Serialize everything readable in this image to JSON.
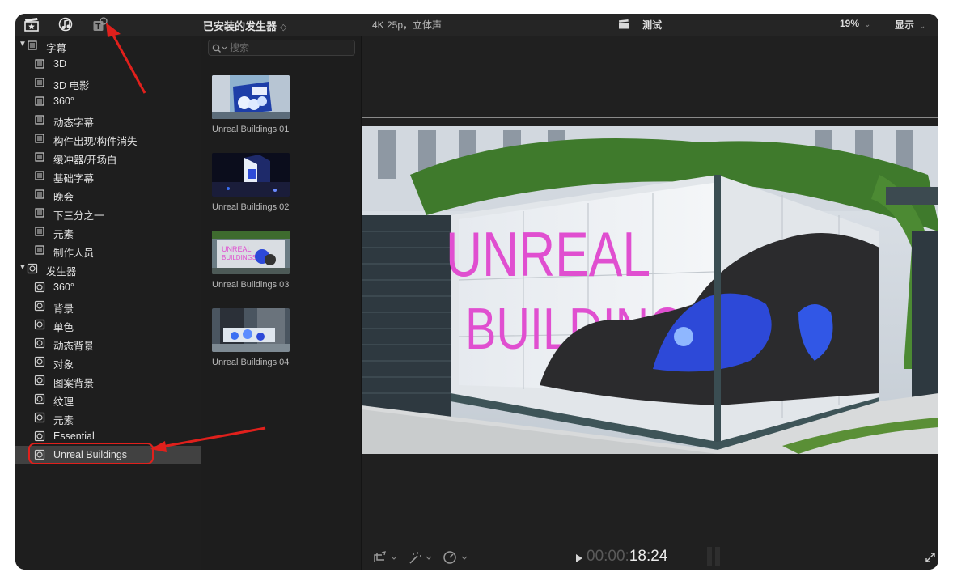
{
  "toolbar": {
    "icons": [
      "clapper-star-icon",
      "music-note-icon",
      "title-t-icon"
    ],
    "browser_title": "已安装的发生器",
    "browser_title_chevron": "◇",
    "format_label": "4K 25p，立体声",
    "project_name": "测试",
    "zoom_level": "19%",
    "display_menu": "显示"
  },
  "sidebar": {
    "groups": [
      {
        "label": "字幕",
        "icon": "title-grid-icon",
        "expanded": true,
        "items": [
          "3D",
          "3D 电影",
          "360°",
          "动态字幕",
          "构件出现/构件消失",
          "缓冲器/开场白",
          "基础字幕",
          "晚会",
          "下三分之一",
          "元素",
          "制作人员"
        ]
      },
      {
        "label": "发生器",
        "icon": "generator-icon",
        "expanded": true,
        "items": [
          "360°",
          "背景",
          "单色",
          "动态背景",
          "对象",
          "图案背景",
          "纹理",
          "元素",
          "Essential",
          "Unreal Buildings"
        ]
      }
    ],
    "selected": "Unreal Buildings"
  },
  "browser": {
    "search_placeholder": "搜索",
    "items": [
      {
        "label": "Unreal Buildings 01"
      },
      {
        "label": "Unreal Buildings 02"
      },
      {
        "label": "Unreal Buildings 03"
      },
      {
        "label": "Unreal Buildings 04"
      }
    ]
  },
  "viewer": {
    "frame_text_line1": "UNREAL",
    "frame_text_line2": "BUILDINGS",
    "timecode_dim": "00:00:",
    "timecode_live": "18:24"
  },
  "colors": {
    "window_bg": "#1f1f1f",
    "selection_bg": "#414141",
    "annotation_red": "#e0201c",
    "neon_pink": "#e04fd0",
    "particle_blue": "#2d49d8"
  }
}
